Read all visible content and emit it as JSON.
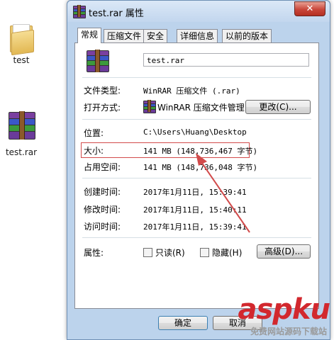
{
  "desktop": {
    "folder_label": "test",
    "rar_label": "test.rar"
  },
  "window": {
    "title": "test.rar 属性",
    "close_glyph": "✕",
    "tabs": [
      "常规",
      "压缩文件",
      "安全",
      "详细信息",
      "以前的版本"
    ],
    "file_name": "test.rar",
    "file_type_label": "文件类型:",
    "file_type_value": "WinRAR 压缩文件 (.rar)",
    "opens_with_label": "打开方式:",
    "opens_with_value": "WinRAR 压缩文件管理",
    "change_button": "更改(C)...",
    "location_label": "位置:",
    "location_value": "C:\\Users\\Huang\\Desktop",
    "size_label": "大小:",
    "size_value": "141 MB (148,736,467 字节)",
    "size_on_disk_label": "占用空间:",
    "size_on_disk_value": "141 MB (148,736,048 字节)",
    "created_label": "创建时间:",
    "created_value": "2017年1月11日, 15:39:41",
    "modified_label": "修改时间:",
    "modified_value": "2017年1月11日, 15:40:11",
    "accessed_label": "访问时间:",
    "accessed_value": "2017年1月11日, 15:39:41",
    "attributes_label": "属性:",
    "readonly_label": "只读(R)",
    "hidden_label": "隐藏(H)",
    "advanced_button": "高级(D)...",
    "ok_button": "确定",
    "cancel_button": "取消"
  },
  "watermark": {
    "logo": "aspku",
    "sub": "免费网站源码下载站"
  },
  "colors": {
    "highlight": "#d24b4b",
    "arrow": "#d24b4b"
  }
}
